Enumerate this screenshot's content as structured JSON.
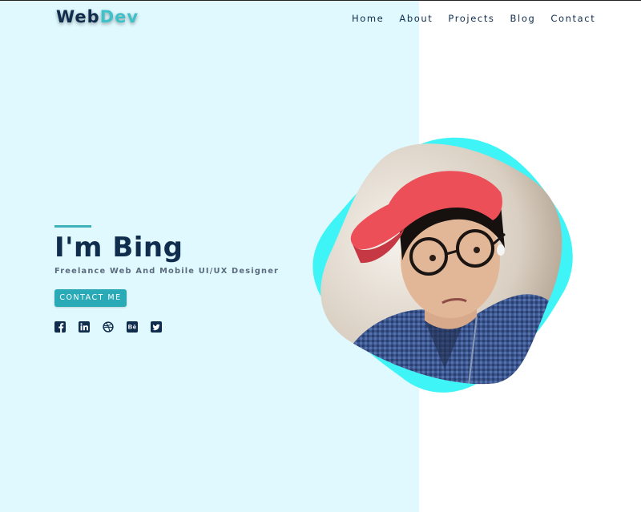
{
  "brand": {
    "logo_part1": "Web",
    "logo_part2": "Dev"
  },
  "nav": {
    "home": "Home",
    "about": "About",
    "projects": "Projects",
    "blog": "Blog",
    "contact": "Contact"
  },
  "hero": {
    "title": "I'm Bing",
    "subtitle": "Freelance Web And Mobile UI/UX Designer",
    "cta_label": "CONTACT ME"
  },
  "socials": [
    {
      "icon": "facebook-icon"
    },
    {
      "icon": "linkedin-icon"
    },
    {
      "icon": "dribbble-icon"
    },
    {
      "icon": "behance-icon"
    },
    {
      "icon": "twitter-icon"
    }
  ],
  "colors": {
    "left_panel": "#dff9fe",
    "navy": "#112d4e",
    "teal_accent": "#3fc1c9",
    "cta_button": "#2aaab6",
    "blob": "#3ff4f7"
  }
}
